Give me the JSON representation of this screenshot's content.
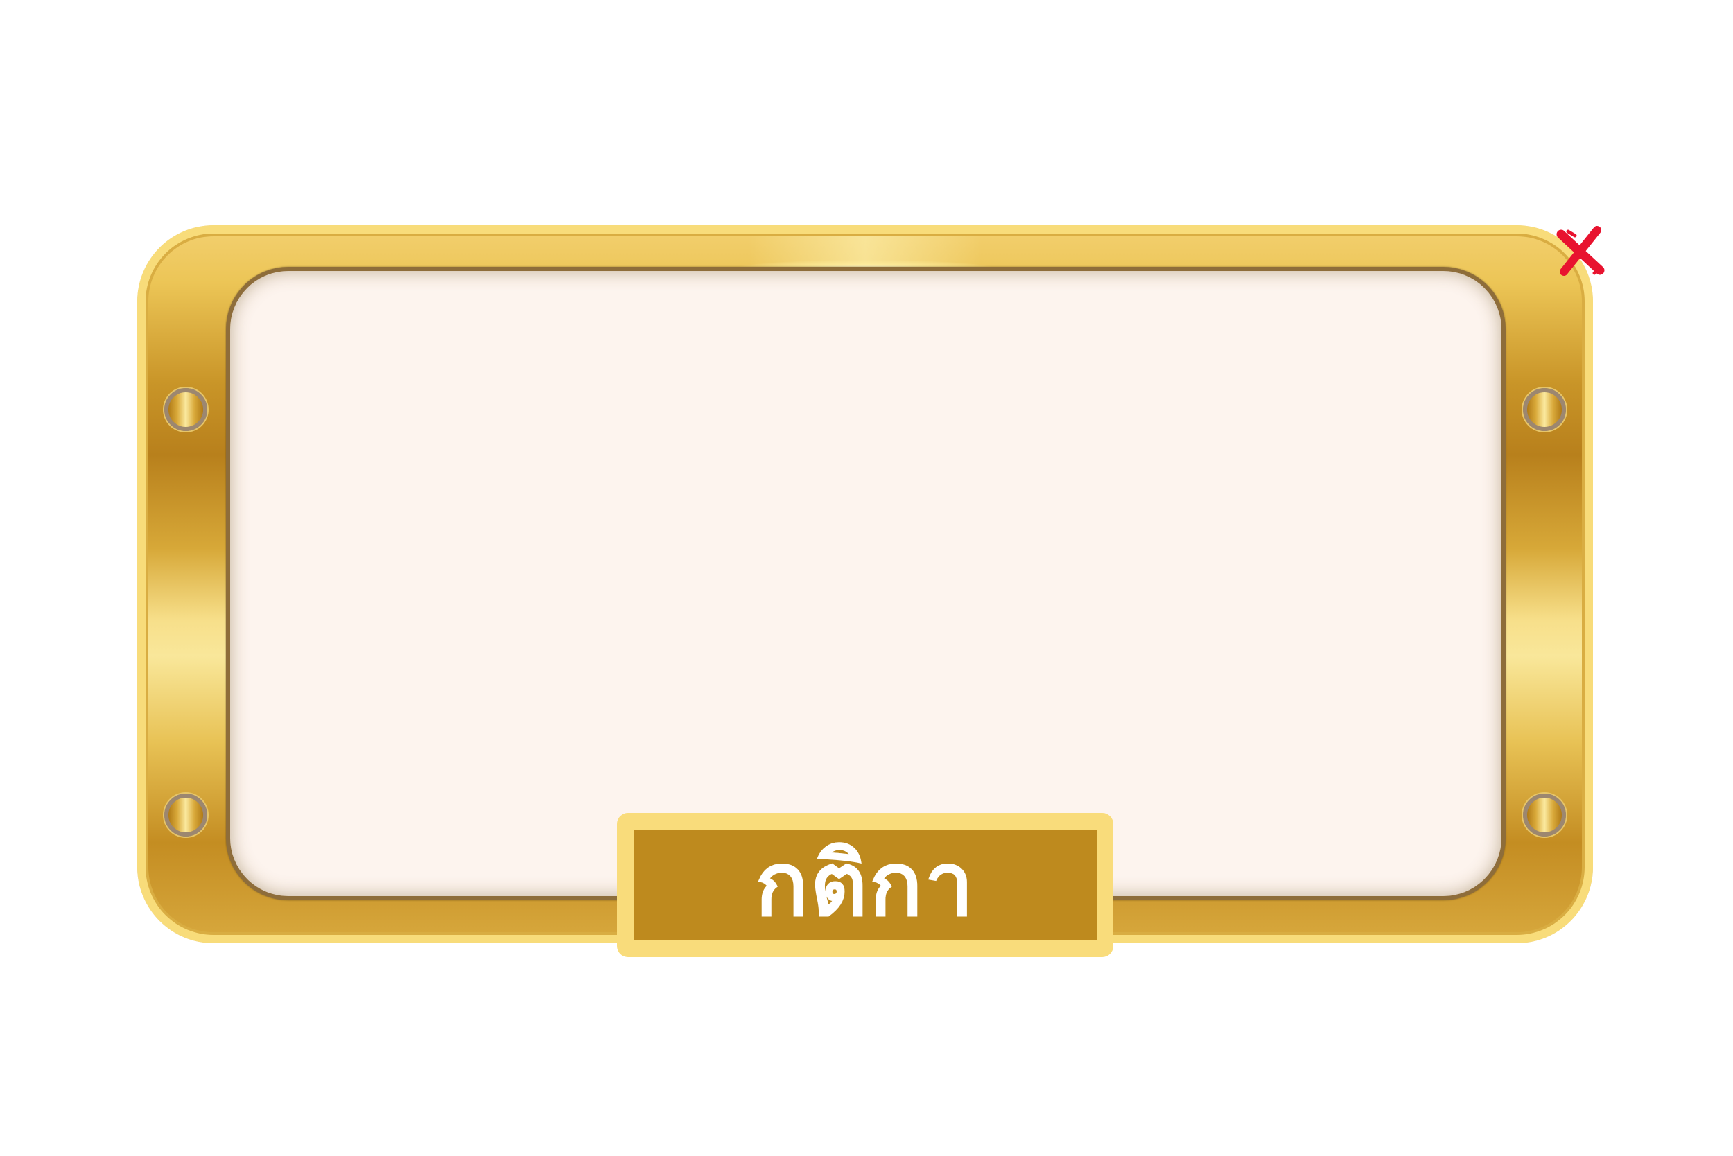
{
  "title": "กติกา",
  "close": {
    "icon": "close-x-icon",
    "color": "#e8132f"
  },
  "colors": {
    "gold_light": "#f9dc7b",
    "gold_dark": "#be8a1e",
    "panel_inner": "#fdf4ee"
  }
}
